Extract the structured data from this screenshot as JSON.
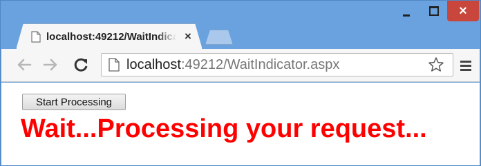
{
  "browser": {
    "tab": {
      "title": "localhost:49212/WaitIndicator.aspx",
      "close_glyph": "×",
      "icon": "page-icon"
    },
    "window_controls": {
      "minimize_icon": "minimize-icon",
      "maximize_icon": "maximize-icon",
      "close_glyph": "×"
    },
    "toolbar": {
      "back_icon": "arrow-left-icon",
      "forward_icon": "arrow-right-icon",
      "reload_icon": "reload-icon",
      "url_host": "localhost",
      "url_rest": ":49212/WaitIndicator.aspx",
      "bookmark_icon": "star-icon",
      "menu_icon": "hamburger-menu-icon"
    },
    "colors": {
      "frame": "#6aa2df",
      "close_button": "#c9463d",
      "message": "#ff0000"
    }
  },
  "page": {
    "start_button_label": "Start Processing",
    "wait_message": "Wait...Processing your request..."
  }
}
